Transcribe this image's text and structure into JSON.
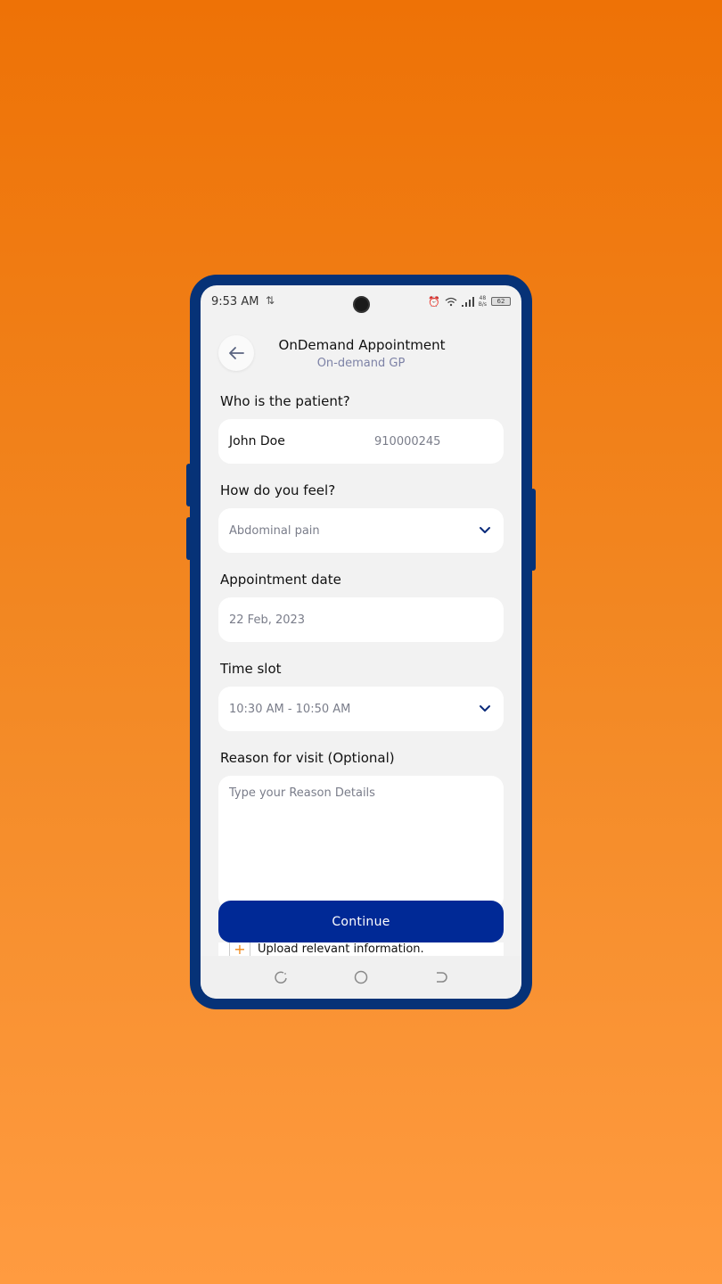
{
  "status_bar": {
    "time": "9:53 AM",
    "net_speed_value": "48",
    "net_speed_unit": "B/s",
    "battery": "62"
  },
  "header": {
    "title": "OnDemand Appointment",
    "subtitle": "On-demand GP"
  },
  "form": {
    "patient": {
      "label": "Who is the patient?",
      "name": "John Doe",
      "phone": "910000245"
    },
    "feel": {
      "label": "How do you feel?",
      "value": "Abdominal pain"
    },
    "date": {
      "label": "Appointment date",
      "value": "22 Feb, 2023"
    },
    "time_slot": {
      "label": "Time slot",
      "value": "10:30 AM - 10:50 AM"
    },
    "reason": {
      "label": "Reason for visit (Optional)",
      "placeholder": "Type your Reason Details"
    },
    "upload": {
      "label": "Upload relevant information."
    }
  },
  "actions": {
    "continue_label": "Continue"
  },
  "colors": {
    "primary": "#002996",
    "frame": "#063277",
    "accent": "#f08a1a",
    "background_top": "#ee7206",
    "background_bottom": "#ff9b40"
  }
}
